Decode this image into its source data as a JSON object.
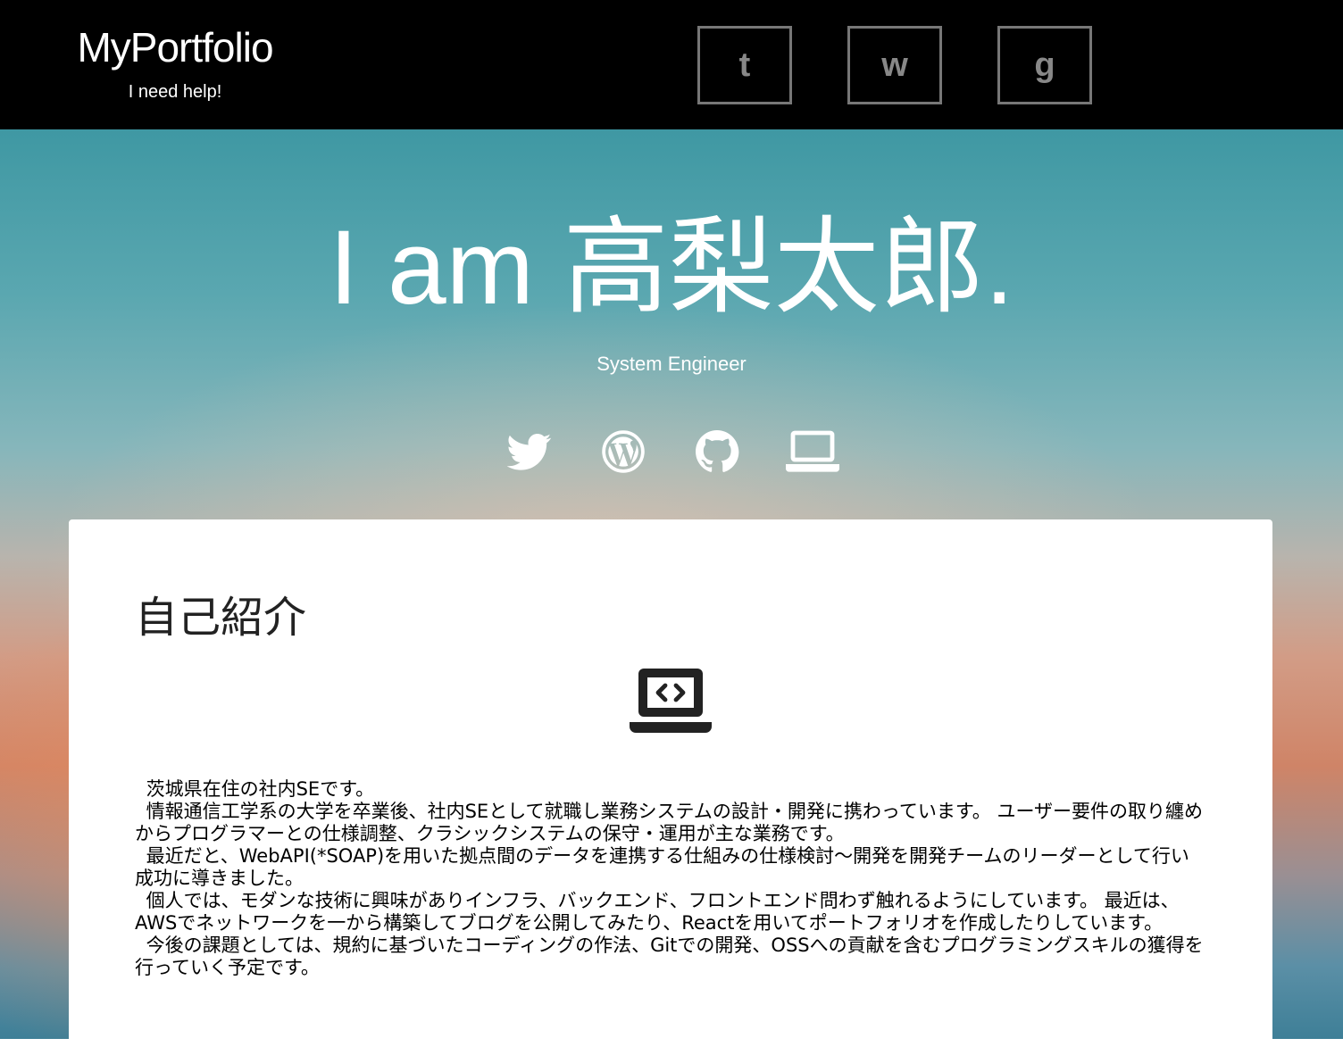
{
  "header": {
    "title": "MyPortfolio",
    "subtitle": "I need help!",
    "nav": [
      {
        "label": "t"
      },
      {
        "label": "w"
      },
      {
        "label": "g"
      }
    ]
  },
  "hero": {
    "title": "I am 高梨太郎.",
    "subtitle": "System Engineer",
    "social_icons": [
      "twitter-icon",
      "wordpress-icon",
      "github-icon",
      "laptop-icon"
    ]
  },
  "about": {
    "heading": "自己紹介",
    "icon": "laptop-code-icon",
    "paragraphs": [
      "茨城県在住の社内SEです。",
      "情報通信工学系の大学を卒業後、社内SEとして就職し業務システムの設計・開発に携わっています。 ユーザー要件の取り纏めからプログラマーとの仕様調整、クラシックシステムの保守・運用が主な業務です。",
      "最近だと、WebAPI(*SOAP)を用いた拠点間のデータを連携する仕組みの仕様検討〜開発を開発チームのリーダーとして行い成功に導きました。",
      "個人では、モダンな技術に興味がありインフラ、バックエンド、フロントエンド問わず触れるようにしています。 最近は、AWSでネットワークを一から構築してブログを公開してみたり、Reactを用いてポートフォリオを作成したりしています。",
      "今後の課題としては、規約に基づいたコーディングの作法、Gitでの開発、OSSへの貢献を含むプログラミングスキルの獲得を行っていく予定です。"
    ]
  },
  "colors": {
    "header_bg": "#000000",
    "nav_border": "#777777",
    "card_bg": "#ffffff"
  }
}
